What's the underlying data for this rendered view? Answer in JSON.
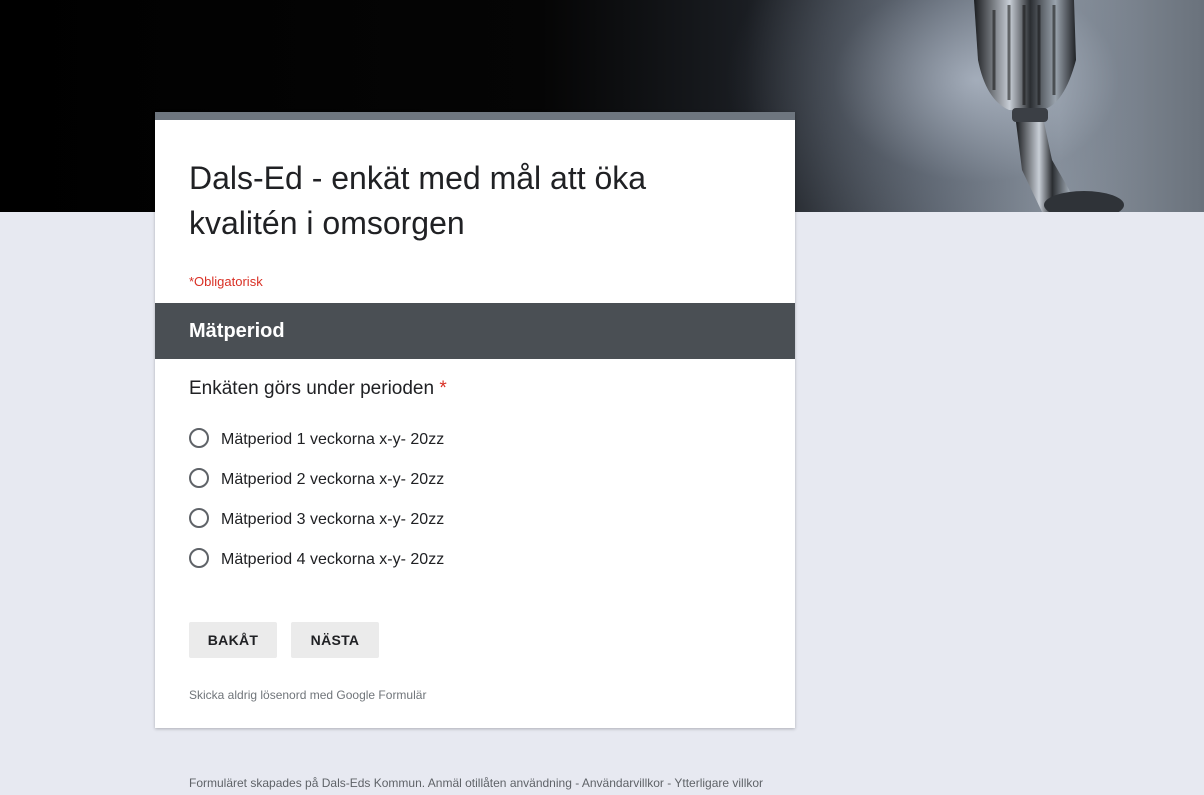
{
  "form": {
    "title": "Dals-Ed - enkät med mål att öka kvalitén i omsorgen",
    "required_note": "*Obligatorisk",
    "section_title": "Mätperiod",
    "question": "Enkäten görs under perioden",
    "required_mark": "*",
    "options": [
      {
        "label": "Mätperiod 1 veckorna x-y- 20zz",
        "selected": false
      },
      {
        "label": "Mätperiod 2 veckorna x-y- 20zz",
        "selected": false
      },
      {
        "label": "Mätperiod 3 veckorna x-y- 20zz",
        "selected": false
      },
      {
        "label": "Mätperiod 4 veckorna x-y- 20zz",
        "selected": false
      }
    ],
    "back_label": "BAKÅT",
    "next_label": "NÄSTA",
    "password_warning": "Skicka aldrig lösenord med Google Formulär"
  },
  "footer": {
    "text": "Formuläret skapades på Dals-Eds Kommun. Anmäl otillåten användning - Användarvillkor - Ytterligare villkor"
  },
  "colors": {
    "page_background": "#e7e9f1",
    "card_top_accent": "#6e767f",
    "section_header": "#4a4f54",
    "required": "#d93025"
  }
}
